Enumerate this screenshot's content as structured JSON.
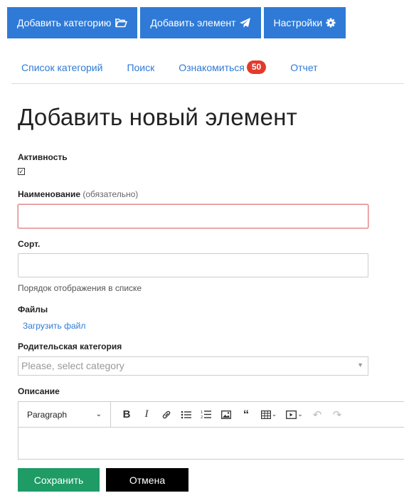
{
  "topbar": {
    "add_category": "Добавить категорию",
    "add_element": "Добавить элемент",
    "settings": "Настройки"
  },
  "tabs": {
    "category_list": "Список категорий",
    "search": "Поиск",
    "review": "Ознакомиться",
    "review_count": "50",
    "report": "Отчет"
  },
  "form": {
    "title": "Добавить новый элемент",
    "active_label": "Активность",
    "active_checked": true,
    "name_label": "Наименование",
    "name_required": "(обязательно)",
    "name_value": "",
    "sort_label": "Сорт.",
    "sort_value": "",
    "sort_help": "Порядок отображения в списке",
    "files_label": "Файлы",
    "upload_link": "Загрузить файл",
    "parent_label": "Родительская категория",
    "parent_placeholder": "Please, select category",
    "description_label": "Описание",
    "editor_block_format": "Paragraph",
    "save": "Сохранить",
    "cancel": "Отмена"
  },
  "icons": {
    "folder": "folder-open-icon",
    "send": "paper-plane-icon",
    "settings": "gear-icon"
  },
  "colors": {
    "primary": "#2f7ad6",
    "badge": "#e33a2b",
    "save": "#1f9b66",
    "cancel": "#000000"
  }
}
